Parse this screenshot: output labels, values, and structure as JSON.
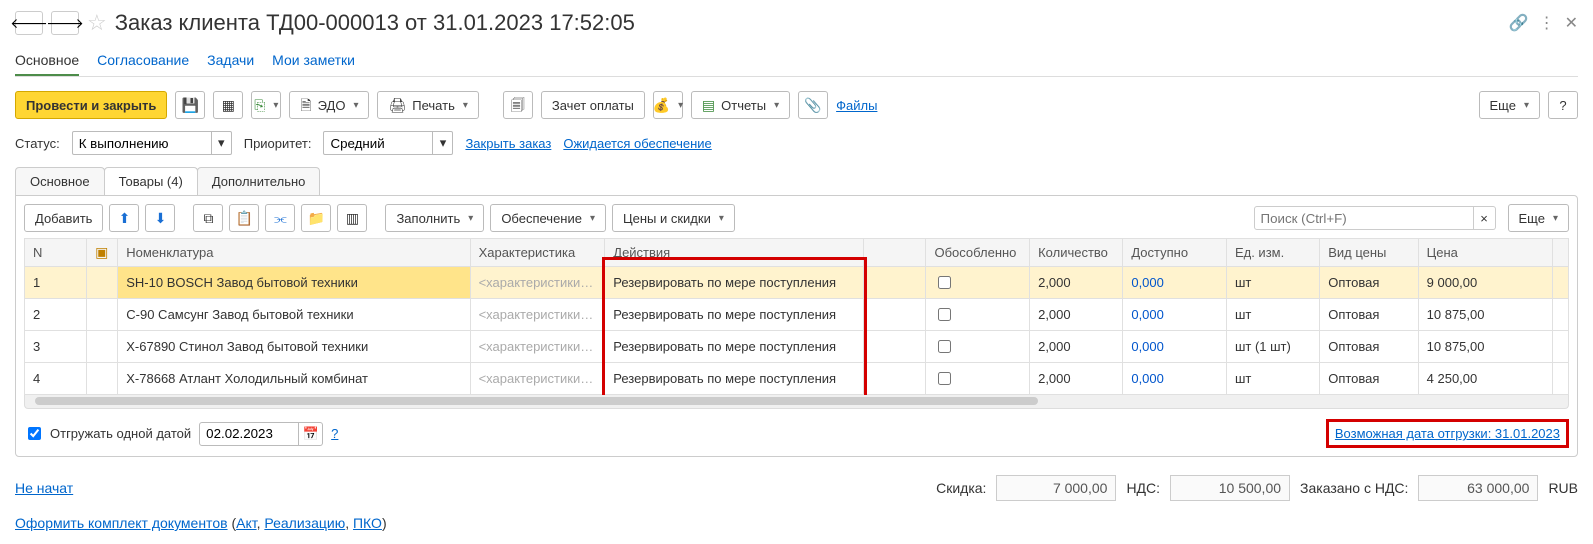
{
  "header": {
    "title": "Заказ клиента ТД00-000013 от 31.01.2023 17:52:05"
  },
  "navtabs": {
    "main": "Основное",
    "approval": "Согласование",
    "tasks": "Задачи",
    "notes": "Мои заметки"
  },
  "toolbar": {
    "post_close": "Провести и закрыть",
    "edo": "ЭДО",
    "print": "Печать",
    "offset": "Зачет оплаты",
    "reports": "Отчеты",
    "files": "Файлы",
    "more": "Еще",
    "help": "?"
  },
  "filters": {
    "status_label": "Статус:",
    "status_value": "К выполнению",
    "priority_label": "Приоритет:",
    "priority_value": "Средний",
    "close_order": "Закрыть заказ",
    "expected_supply": "Ожидается обеспечение"
  },
  "doctabs": {
    "main": "Основное",
    "goods": "Товары (4)",
    "extra": "Дополнительно"
  },
  "panel_toolbar": {
    "add": "Добавить",
    "fill": "Заполнить",
    "supply": "Обеспечение",
    "prices": "Цены и скидки",
    "search_placeholder": "Поиск (Ctrl+F)",
    "more": "Еще"
  },
  "columns": {
    "n": "N",
    "nom": "Номенклатура",
    "char": "Характеристика",
    "act": "Действия",
    "obos": "Обособленно",
    "qty": "Количество",
    "avail": "Доступно",
    "unit": "Ед. изм.",
    "price_type": "Вид цены",
    "price": "Цена"
  },
  "char_placeholder": "<характеристики …",
  "rows": [
    {
      "n": "1",
      "nom": "SH-10 BOSCH Завод бытовой техники",
      "act": "Резервировать по мере поступления",
      "qty": "2,000",
      "avail": "0,000",
      "unit": "шт",
      "ptype": "Оптовая",
      "price": "9 000,00"
    },
    {
      "n": "2",
      "nom": "С-90 Самсунг Завод бытовой техники",
      "act": "Резервировать по мере поступления",
      "qty": "2,000",
      "avail": "0,000",
      "unit": "шт",
      "ptype": "Оптовая",
      "price": "10 875,00"
    },
    {
      "n": "3",
      "nom": "Х-67890 Стинол Завод бытовой техники",
      "act": "Резервировать по мере поступления",
      "qty": "2,000",
      "avail": "0,000",
      "unit": "шт (1 шт)",
      "ptype": "Оптовая",
      "price": "10 875,00"
    },
    {
      "n": "4",
      "nom": "Х-78668 Атлант Холодильный комбинат",
      "act": "Резервировать по мере поступления",
      "qty": "2,000",
      "avail": "0,000",
      "unit": "шт",
      "ptype": "Оптовая",
      "price": "4 250,00"
    }
  ],
  "footer": {
    "ship_single": "Отгружать одной датой",
    "ship_date": "02.02.2023",
    "possible_ship": "Возможная дата отгрузки: 31.01.2023",
    "not_started": "Не начат"
  },
  "totals": {
    "discount_label": "Скидка:",
    "discount_val": "7 000,00",
    "vat_label": "НДС:",
    "vat_val": "10 500,00",
    "ordered_label": "Заказано с НДС:",
    "ordered_val": "63 000,00",
    "currency": "RUB"
  },
  "bottom": {
    "prefix": "Оформить комплект документов",
    "act": "Акт",
    "real": "Реализацию",
    "pko": "ПКО"
  }
}
